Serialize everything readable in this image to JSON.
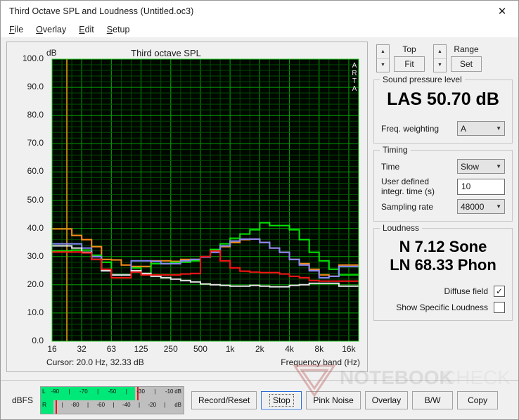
{
  "window": {
    "title": "Third Octave SPL and Loudness (Untitled.oc3)",
    "close_icon": "close-icon",
    "close_glyph": "✕"
  },
  "menu": [
    {
      "label": "File",
      "mnemonic": "F",
      "rest": "ile"
    },
    {
      "label": "Overlay",
      "mnemonic": "O",
      "rest": "verlay"
    },
    {
      "label": "Edit",
      "mnemonic": "E",
      "rest": "dit"
    },
    {
      "label": "Setup",
      "mnemonic": "S",
      "rest": "etup"
    }
  ],
  "chart_panel": {
    "title": "Third octave SPL",
    "y_unit": "dB",
    "watermark_brand": "ARTA",
    "cursor_text": "Cursor:   20.0 Hz, 32.33 dB",
    "x_axis_title": "Frequency band (Hz)",
    "cursor_line_color": "#b8860b",
    "cursor_freq_hz": 20.0,
    "cursor_level_db": 32.33
  },
  "chart_data": {
    "type": "line",
    "title": "Third octave SPL",
    "xlabel": "Frequency band (Hz)",
    "ylabel": "dB",
    "ylim": [
      0.0,
      100.0
    ],
    "ytick_step": 10.0,
    "yticks": [
      "100.0",
      "90.0",
      "80.0",
      "70.0",
      "60.0",
      "50.0",
      "40.0",
      "30.0",
      "20.0",
      "10.0",
      "0.0"
    ],
    "xticks": [
      "16",
      "32",
      "63",
      "125",
      "250",
      "500",
      "1k",
      "2k",
      "4k",
      "8k",
      "16k"
    ],
    "grid": true,
    "grid_color": "#00a000",
    "plot_bg": "#000800",
    "legend": "none",
    "x_bands_hz": [
      16,
      20,
      25,
      31.5,
      40,
      50,
      63,
      80,
      100,
      125,
      160,
      200,
      250,
      315,
      400,
      500,
      630,
      800,
      1000,
      1250,
      1600,
      2000,
      2500,
      3150,
      4000,
      5000,
      6300,
      8000,
      10000,
      12500,
      16000
    ],
    "series": [
      {
        "name": "orange-trace",
        "color": "#ff8c1a",
        "values": [
          39.8,
          39.8,
          37.5,
          36.0,
          33.5,
          29.0,
          28.8,
          27.0,
          26.5,
          26.5,
          28.5,
          28.5,
          28.3,
          29.0,
          29.0,
          29.8,
          31.5,
          33.5,
          35.0,
          36.0,
          36.2,
          35.0,
          33.0,
          31.5,
          29.0,
          27.5,
          25.5,
          23.5,
          23.0,
          27.0,
          27.0
        ]
      },
      {
        "name": "green-trace",
        "color": "#00e800",
        "values": [
          32.0,
          32.0,
          32.3,
          32.3,
          30.5,
          28.0,
          23.5,
          23.5,
          26.0,
          24.0,
          27.5,
          27.5,
          28.0,
          28.0,
          28.5,
          30.0,
          32.5,
          34.5,
          36.5,
          38.0,
          39.5,
          42.0,
          41.0,
          41.0,
          39.5,
          36.0,
          31.5,
          28.5,
          25.5,
          23.5,
          23.5
        ]
      },
      {
        "name": "blue-trace",
        "color": "#8b8bff",
        "values": [
          34.5,
          34.5,
          34.5,
          33.0,
          30.0,
          25.0,
          23.5,
          23.5,
          28.5,
          28.5,
          28.3,
          27.5,
          27.5,
          28.5,
          29.0,
          29.8,
          31.5,
          33.8,
          35.5,
          36.2,
          36.2,
          35.0,
          33.0,
          31.5,
          29.0,
          27.0,
          25.0,
          22.5,
          23.0,
          26.5,
          26.5
        ]
      },
      {
        "name": "red-trace",
        "color": "#ff1414",
        "values": [
          31.6,
          31.6,
          31.6,
          31.3,
          29.0,
          25.5,
          22.5,
          22.5,
          24.5,
          23.5,
          23.5,
          23.5,
          23.5,
          23.8,
          24.0,
          30.0,
          32.0,
          28.5,
          26.0,
          24.8,
          24.5,
          24.3,
          24.3,
          23.8,
          23.0,
          22.5,
          21.5,
          21.3,
          21.3,
          21.3,
          21.3
        ]
      },
      {
        "name": "white-trace",
        "color": "#e8e8e8",
        "values": [
          33.8,
          33.8,
          33.0,
          31.5,
          29.0,
          25.0,
          23.5,
          23.5,
          25.0,
          24.0,
          23.0,
          22.5,
          22.0,
          21.5,
          21.0,
          20.3,
          20.0,
          19.8,
          19.5,
          19.5,
          19.8,
          19.5,
          19.3,
          19.3,
          19.8,
          20.0,
          20.5,
          20.5,
          20.5,
          19.5,
          19.5
        ]
      }
    ]
  },
  "side": {
    "top_group": {
      "label": "Top",
      "button": "Fit"
    },
    "range_group": {
      "label": "Range",
      "button": "Set"
    },
    "spl": {
      "legend": "Sound pressure level",
      "value": "LAS 50.70 dB",
      "weighting_label": "Freq. weighting",
      "weighting_value": "A"
    },
    "timing": {
      "legend": "Timing",
      "time_label": "Time",
      "time_value": "Slow",
      "integr_label_line1": "User defined",
      "integr_label_line2": "integr. time (s)",
      "integr_value": "10",
      "sampling_label": "Sampling rate",
      "sampling_value": "48000"
    },
    "loudness": {
      "legend": "Loudness",
      "sone": "N 7.12 Sone",
      "phon": "LN 68.33 Phon",
      "diffuse_label": "Diffuse field",
      "diffuse_checked": true,
      "specific_label": "Show Specific Loudness",
      "specific_checked": false,
      "check_glyph": "✓"
    }
  },
  "bottom": {
    "dbfs_label": "dBFS",
    "meter": {
      "left_channel": "L",
      "right_channel": "R",
      "unit": "dB",
      "left_ticks": [
        "-90",
        "|",
        "-70",
        "|",
        "-50",
        "|",
        "-30",
        "|",
        "-10"
      ],
      "right_ticks": [
        "|",
        "-80",
        "|",
        "-60",
        "|",
        "-40",
        "|",
        "-20",
        "|"
      ],
      "left_fill_pct": 66,
      "left_peak_pct": 67.5,
      "right_fill_pct": 9,
      "right_peak_pct": 10.5,
      "fill_color": "#00e878",
      "peak_color": "#e81414"
    },
    "buttons": [
      {
        "label": "Record/Reset",
        "focused": false
      },
      {
        "label": "Stop",
        "focused": true
      },
      {
        "label": "Pink Noise",
        "focused": false
      },
      {
        "label": "Overlay",
        "focused": false
      },
      {
        "label": "B/W",
        "focused": false
      },
      {
        "label": "Copy",
        "focused": false
      }
    ]
  },
  "watermark": {
    "text1": "NOTEBOOK",
    "text2": "CHECK"
  }
}
